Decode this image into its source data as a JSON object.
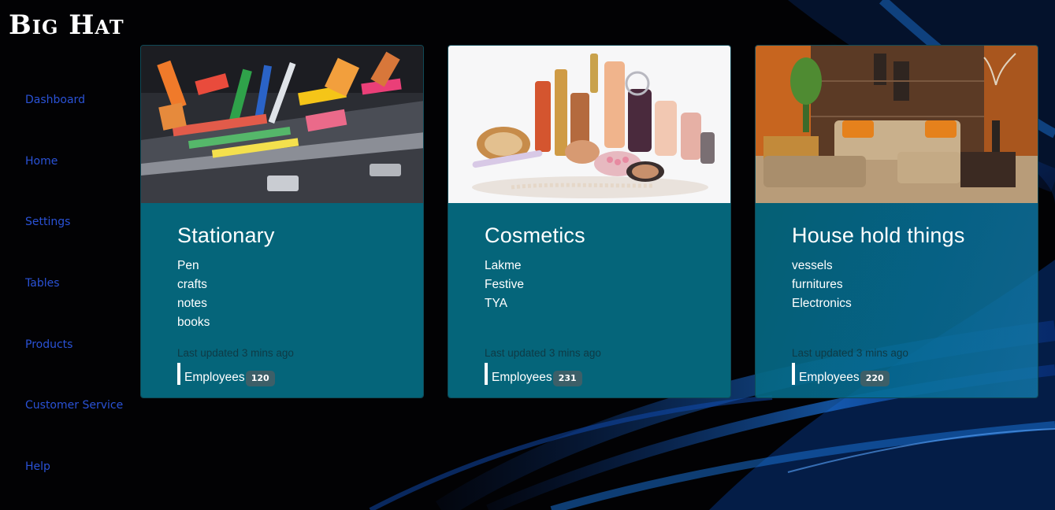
{
  "brand": {
    "name": "Big Hat"
  },
  "sidebar": {
    "items": [
      {
        "label": "Dashboard"
      },
      {
        "label": "Home"
      },
      {
        "label": "Settings"
      },
      {
        "label": "Tables"
      },
      {
        "label": "Products"
      },
      {
        "label": "Customer Service"
      },
      {
        "label": "Help"
      }
    ]
  },
  "cards": [
    {
      "title": "Stationary",
      "items": [
        "Pen",
        "crafts",
        "notes",
        "books"
      ],
      "updated": "Last updated 3 mins ago",
      "employees_label": "Employees",
      "employees_count": "120",
      "image": "stationery-case-photo"
    },
    {
      "title": "Cosmetics",
      "items": [
        "Lakme",
        "Festive",
        "TYA"
      ],
      "updated": "Last updated 3 mins ago",
      "employees_label": "Employees",
      "employees_count": "231",
      "image": "cosmetics-products-photo"
    },
    {
      "title": "House hold things",
      "items": [
        "vessels",
        "furnitures",
        "Electronics"
      ],
      "updated": "Last updated 3 mins ago",
      "employees_label": "Employees",
      "employees_count": "220",
      "image": "living-room-photo"
    }
  ],
  "colors": {
    "background": "#020204",
    "nav_link": "#2a52d6",
    "card_body": "#05657a",
    "badge": "#3d5f68",
    "accent_blue": "#1a6fd0"
  }
}
